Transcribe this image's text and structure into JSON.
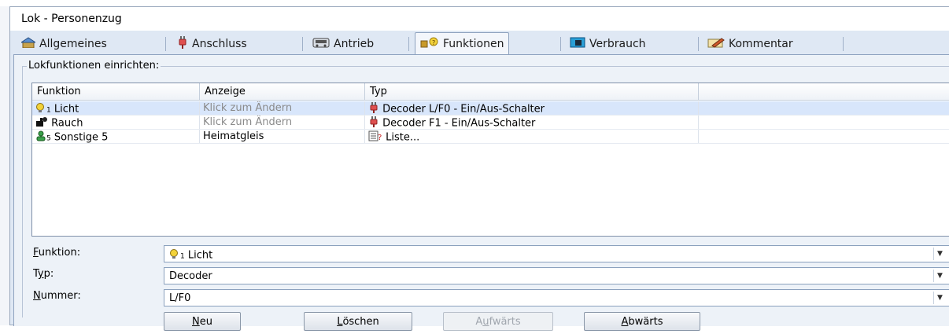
{
  "window": {
    "title": "Lok - Personenzug"
  },
  "tabs": [
    {
      "label": "Allgemeines",
      "icon": "house-icon"
    },
    {
      "label": "Anschluss",
      "icon": "plug-icon"
    },
    {
      "label": "Antrieb",
      "icon": "engine-icon"
    },
    {
      "label": "Funktionen",
      "icon": "functions-icon",
      "active": true
    },
    {
      "label": "Verbrauch",
      "icon": "consumption-icon"
    },
    {
      "label": "Kommentar",
      "icon": "pencil-icon"
    }
  ],
  "group": {
    "label": "Lokfunktionen einrichten:"
  },
  "list": {
    "columns": [
      "Funktion",
      "Anzeige",
      "Typ"
    ],
    "rows": [
      {
        "funktion": "Licht",
        "anzeige": "Klick zum Ändern",
        "typ": "Decoder L/F0 - Ein/Aus-Schalter",
        "selected": true
      },
      {
        "funktion": "Rauch",
        "anzeige": "Klick zum Ändern",
        "typ": "Decoder F1 - Ein/Aus-Schalter",
        "selected": false
      },
      {
        "funktion": "Sonstige 5",
        "anzeige": "Heimatgleis",
        "typ": "Liste...",
        "selected": false
      }
    ]
  },
  "form": {
    "funktion_label_ul": "F",
    "funktion_label_rest": "unktion:",
    "funktion_value": "Licht",
    "typ_label_pre": "T",
    "typ_label_ul": "y",
    "typ_label_rest": "p:",
    "typ_value": "Decoder",
    "nummer_label_ul": "N",
    "nummer_label_rest": "ummer:",
    "nummer_value": "L/F0"
  },
  "buttons": {
    "neu_ul": "N",
    "neu_rest": "eu",
    "loeschen_ul": "L",
    "loeschen_rest": "öschen",
    "aufwaerts_pre": "A",
    "aufwaerts_ul": "u",
    "aufwaerts_rest": "fwärts",
    "abwaerts_ul": "A",
    "abwaerts_rest": "bwärts"
  },
  "colors": {
    "selection": "#d8e6fb",
    "panel": "#edf2f8",
    "frame": "#dfe8f4"
  }
}
